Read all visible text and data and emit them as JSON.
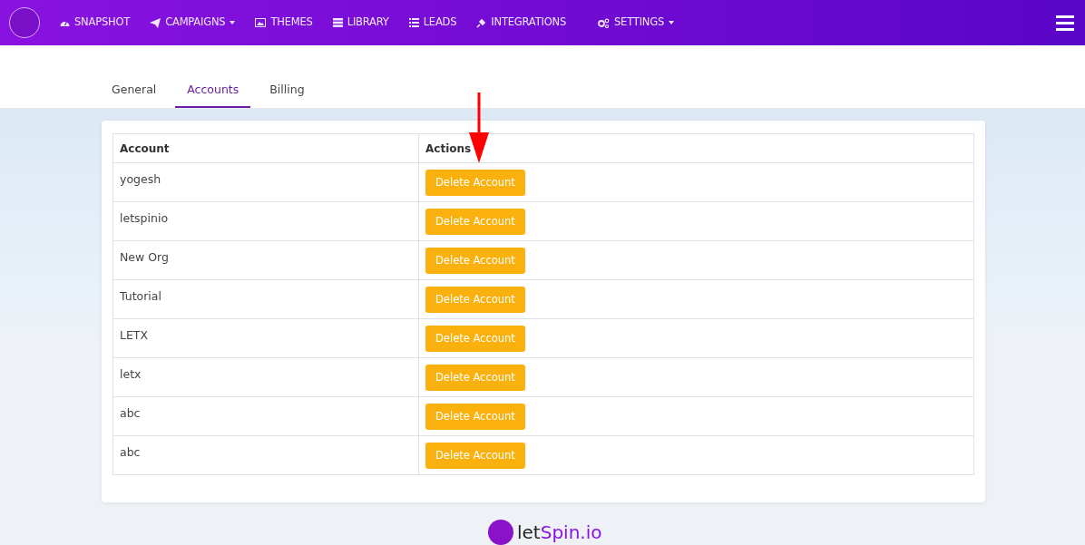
{
  "navbar": {
    "items": [
      {
        "label": "SNAPSHOT",
        "dropdown": false
      },
      {
        "label": "CAMPAIGNS",
        "dropdown": true
      },
      {
        "label": "THEMES",
        "dropdown": false
      },
      {
        "label": "LIBRARY",
        "dropdown": false
      },
      {
        "label": "LEADS",
        "dropdown": false
      },
      {
        "label": "INTEGRATIONS",
        "dropdown": false
      },
      {
        "label": "SETTINGS",
        "dropdown": true
      }
    ]
  },
  "tabs": [
    {
      "label": "General",
      "selected": false
    },
    {
      "label": "Accounts",
      "selected": true
    },
    {
      "label": "Billing",
      "selected": false
    }
  ],
  "table": {
    "columns": [
      "Account",
      "Actions"
    ],
    "rows": [
      {
        "account": "yogesh",
        "action": "Delete Account"
      },
      {
        "account": "letspinio",
        "action": "Delete Account"
      },
      {
        "account": "New Org",
        "action": "Delete Account"
      },
      {
        "account": "Tutorial",
        "action": "Delete Account"
      },
      {
        "account": "LETX",
        "action": "Delete Account"
      },
      {
        "account": "letx",
        "action": "Delete Account"
      },
      {
        "account": "abc",
        "action": "Delete Account"
      },
      {
        "account": "abc",
        "action": "Delete Account"
      }
    ]
  },
  "footer_logo": {
    "prefix": "let",
    "suffix": "Spin.io"
  }
}
